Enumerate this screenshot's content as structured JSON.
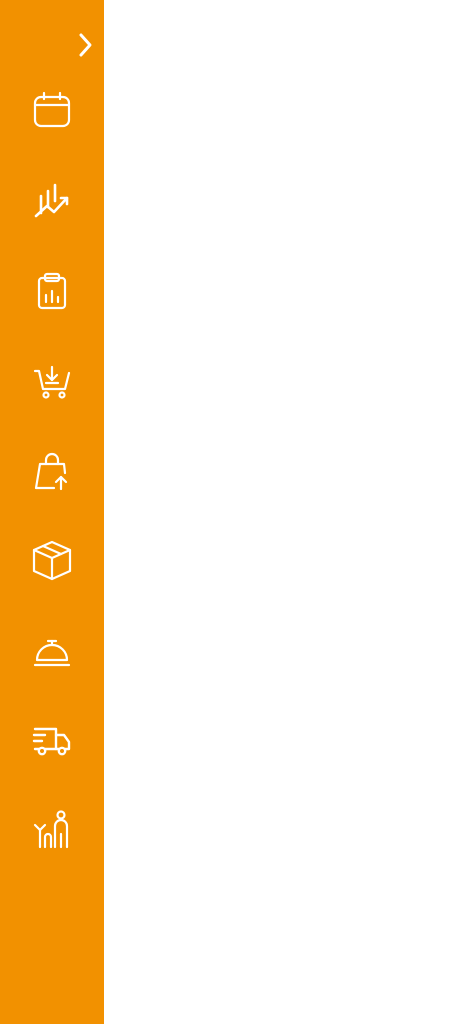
{
  "theme": {
    "sidebar_color": "#f29100",
    "icon_color": "#ffffff",
    "main_background": "#ffffff"
  },
  "sidebar": {
    "expand_icon": "chevron-right-icon",
    "items": [
      {
        "id": "calendar",
        "icon": "calendar-icon"
      },
      {
        "id": "analytics",
        "icon": "chart-trend-icon"
      },
      {
        "id": "reports",
        "icon": "clipboard-chart-icon"
      },
      {
        "id": "purchases",
        "icon": "cart-download-icon"
      },
      {
        "id": "sales",
        "icon": "bag-upload-icon"
      },
      {
        "id": "products",
        "icon": "box-icon"
      },
      {
        "id": "service",
        "icon": "service-bell-icon"
      },
      {
        "id": "delivery",
        "icon": "delivery-truck-icon"
      },
      {
        "id": "customers",
        "icon": "people-icon"
      }
    ]
  }
}
